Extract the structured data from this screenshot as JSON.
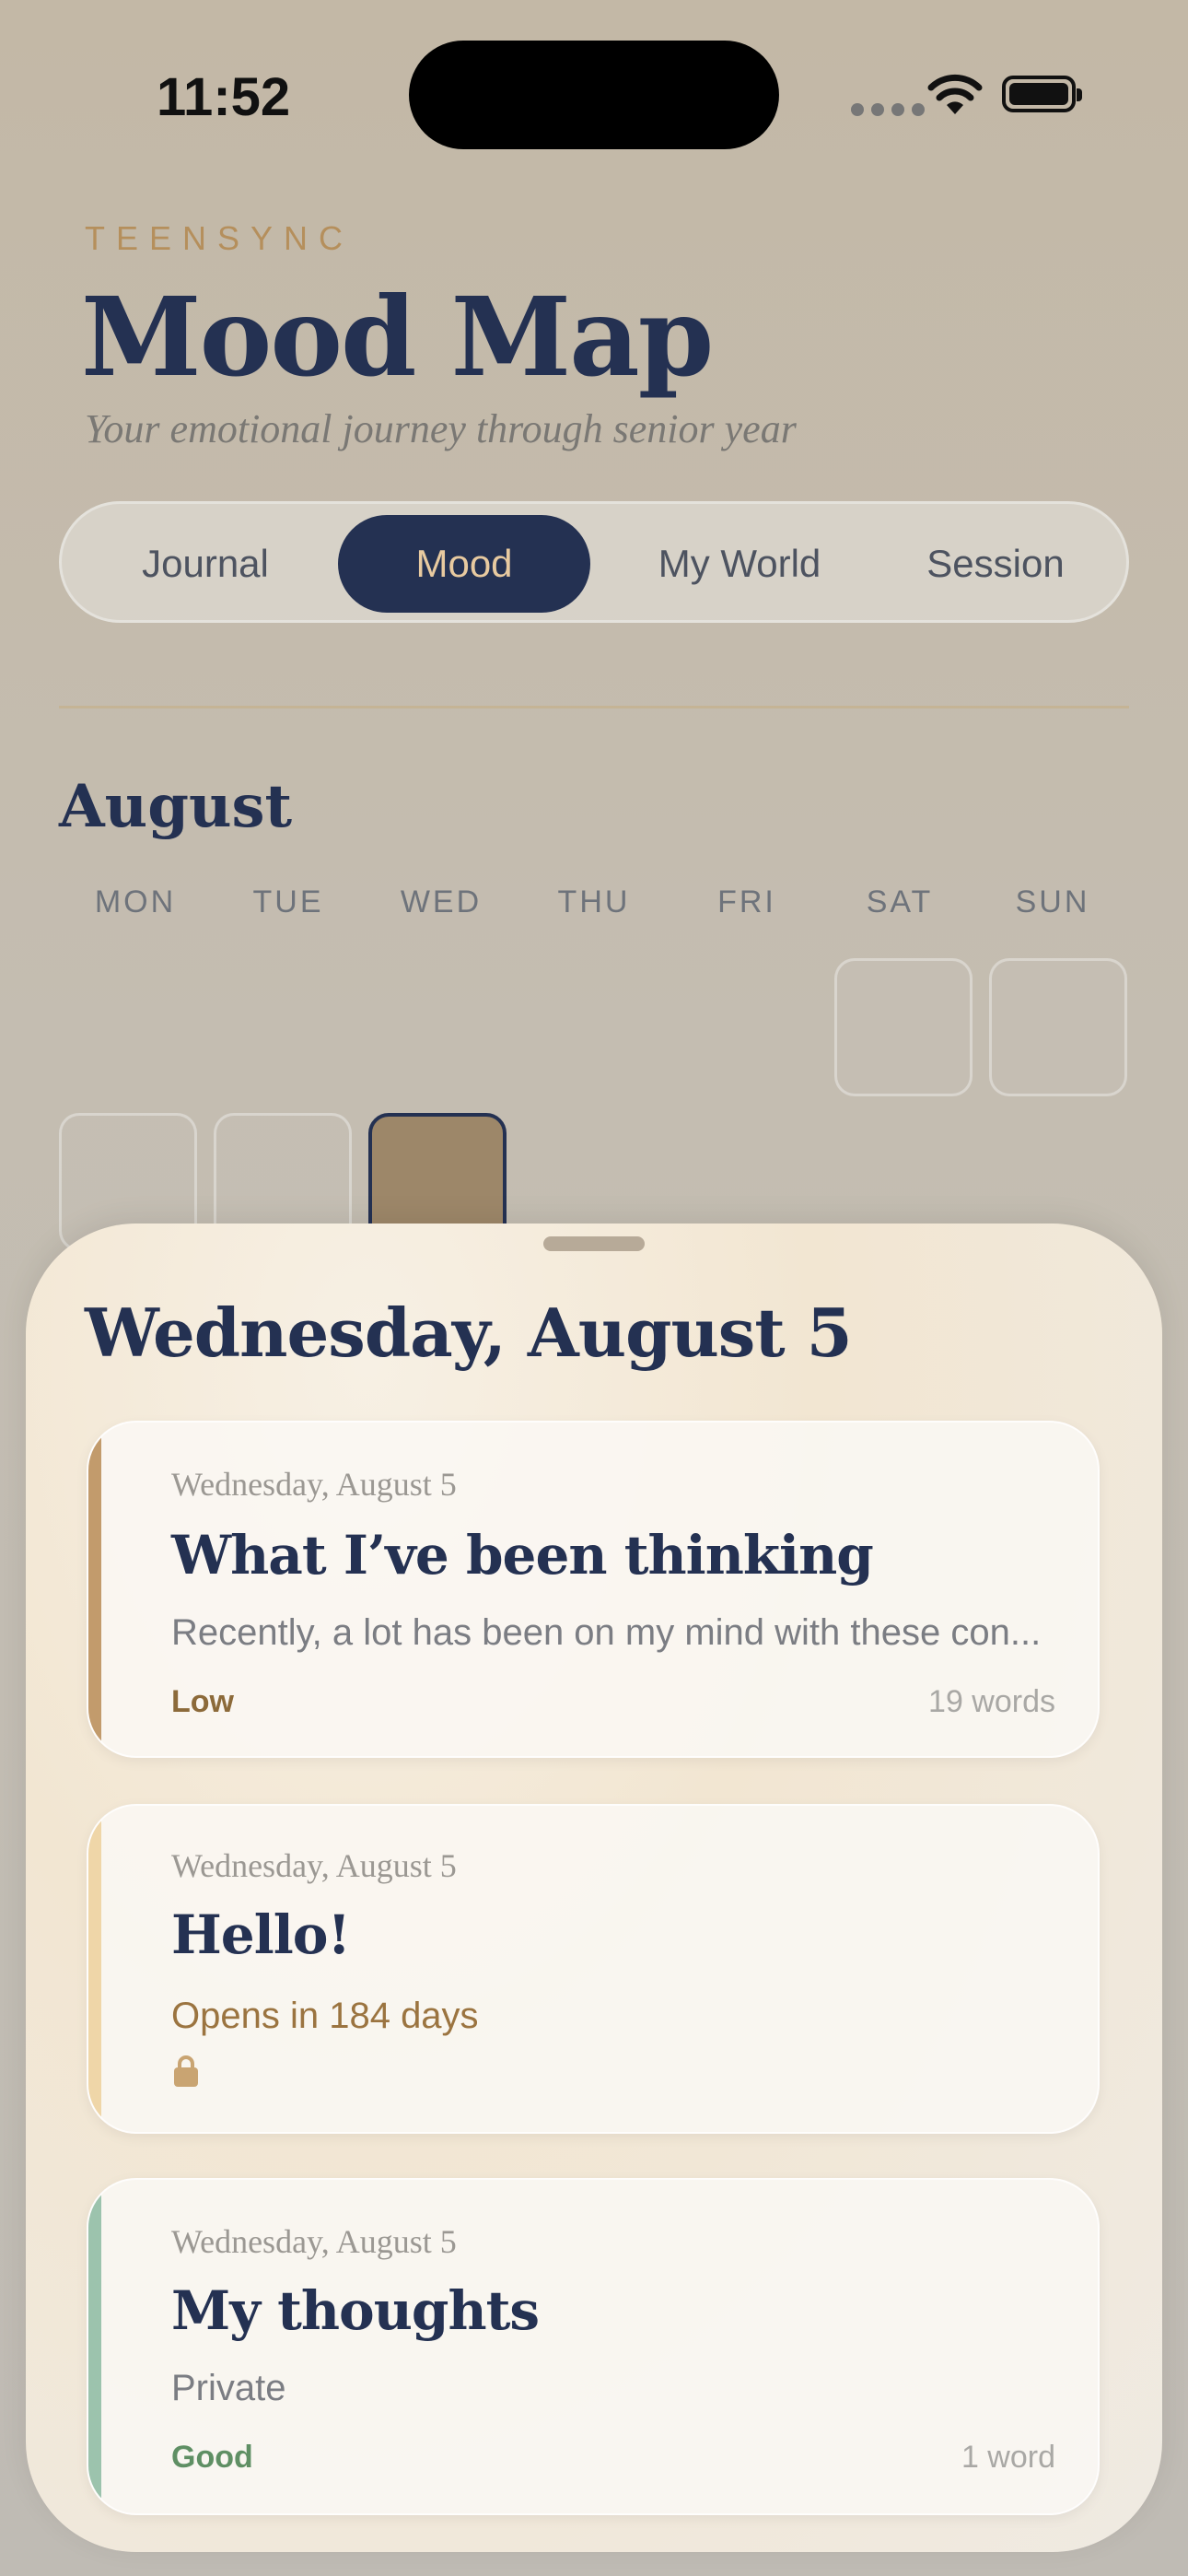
{
  "status_bar": {
    "time": "11:52"
  },
  "header": {
    "brand": "TEENSYNC",
    "title": "Mood Map",
    "subtitle": "Your emotional journey through senior year"
  },
  "tabs": [
    {
      "label": "Journal",
      "active": false
    },
    {
      "label": "Mood",
      "active": true
    },
    {
      "label": "My World",
      "active": false
    },
    {
      "label": "Session",
      "active": false
    }
  ],
  "calendar": {
    "month": "August",
    "weekdays": [
      "MON",
      "TUE",
      "WED",
      "THU",
      "FRI",
      "SAT",
      "SUN"
    ],
    "selected_day_color": "#9d8769"
  },
  "sheet": {
    "title": "Wednesday, August 5",
    "entries": [
      {
        "date": "Wednesday, August 5",
        "title": "What I’ve been thinking",
        "excerpt": "Recently, a lot has been on my mind with these con...",
        "mood": "Low",
        "word_count": "19 words",
        "accent_color": "#c29b6c",
        "mood_color": "#8c6a3a"
      },
      {
        "date": "Wednesday, August 5",
        "title": "Hello!",
        "status": "Opens in 184 days",
        "icon": "lock-icon",
        "accent_color": "#efd6a8",
        "status_color": "#9b7440"
      },
      {
        "date": "Wednesday, August 5",
        "title": "My thoughts",
        "excerpt": "Private",
        "mood": "Good",
        "word_count": "1 word",
        "accent_color": "#9cc3ad",
        "mood_color": "#5f8f64"
      }
    ]
  }
}
